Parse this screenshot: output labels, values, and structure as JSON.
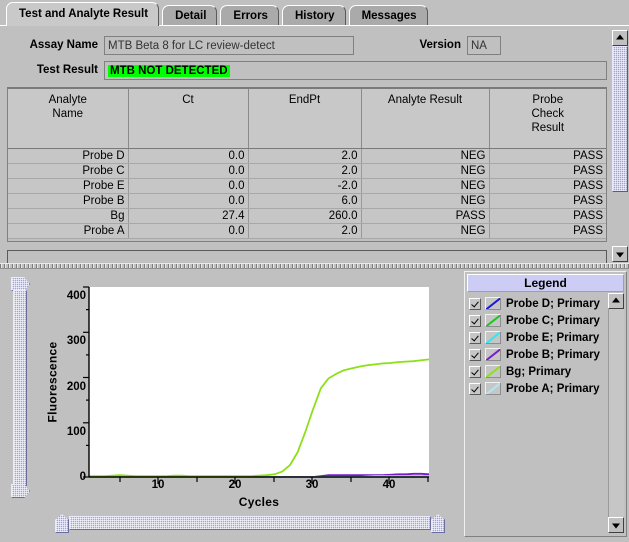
{
  "tabs": [
    {
      "label": "Test and Analyte Result",
      "active": true
    },
    {
      "label": "Detail",
      "active": false
    },
    {
      "label": "Errors",
      "active": false
    },
    {
      "label": "History",
      "active": false
    },
    {
      "label": "Messages",
      "active": false
    }
  ],
  "fields": {
    "assay_name_label": "Assay Name",
    "assay_name_value": "MTB Beta 8 for LC review-detect",
    "version_label": "Version",
    "version_value": "NA",
    "test_result_label": "Test Result",
    "test_result_value": "MTB NOT DETECTED",
    "test_result_highlight": "#00ff00"
  },
  "table": {
    "columns": [
      "Analyte\nName",
      "Ct",
      "EndPt",
      "Analyte Result",
      "Probe\nCheck\nResult"
    ],
    "columns_display": [
      {
        "line1": "Analyte",
        "line2": "Name",
        "line3": ""
      },
      {
        "line1": "Ct",
        "line2": "",
        "line3": ""
      },
      {
        "line1": "EndPt",
        "line2": "",
        "line3": ""
      },
      {
        "line1": "Analyte Result",
        "line2": "",
        "line3": ""
      },
      {
        "line1": "Probe",
        "line2": "Check",
        "line3": "Result"
      }
    ],
    "rows": [
      {
        "analyte": "Probe D",
        "ct": "0.0",
        "endpt": "2.0",
        "analyte_result": "NEG",
        "probe_check": "PASS"
      },
      {
        "analyte": "Probe C",
        "ct": "0.0",
        "endpt": "2.0",
        "analyte_result": "NEG",
        "probe_check": "PASS"
      },
      {
        "analyte": "Probe E",
        "ct": "0.0",
        "endpt": "-2.0",
        "analyte_result": "NEG",
        "probe_check": "PASS"
      },
      {
        "analyte": "Probe B",
        "ct": "0.0",
        "endpt": "6.0",
        "analyte_result": "NEG",
        "probe_check": "PASS"
      },
      {
        "analyte": "Bg",
        "ct": "27.4",
        "endpt": "260.0",
        "analyte_result": "PASS",
        "probe_check": "PASS"
      },
      {
        "analyte": "Probe A",
        "ct": "0.0",
        "endpt": "2.0",
        "analyte_result": "NEG",
        "probe_check": "PASS"
      }
    ]
  },
  "legend": {
    "title": "Legend",
    "items": [
      {
        "label": "Probe D; Primary",
        "color": "#1818d8",
        "checked": true
      },
      {
        "label": "Probe C; Primary",
        "color": "#18c818",
        "checked": true
      },
      {
        "label": "Probe E; Primary",
        "color": "#30e8f0",
        "checked": true
      },
      {
        "label": "Probe B; Primary",
        "color": "#7a1ad0",
        "checked": true
      },
      {
        "label": "Bg; Primary",
        "color": "#8ce018",
        "checked": true
      },
      {
        "label": "Probe A; Primary",
        "color": "#b0e8f0",
        "checked": true
      }
    ]
  },
  "chart_data": {
    "type": "line",
    "title": "",
    "xlabel": "Cycles",
    "ylabel": "Fluorescence",
    "xlim": [
      1,
      45
    ],
    "ylim": [
      0,
      420
    ],
    "xticks": [
      10,
      20,
      30,
      40
    ],
    "xminor_step": 5,
    "yticks": [
      0,
      100,
      200,
      300,
      400
    ],
    "yminor": [
      50,
      150,
      250,
      350
    ],
    "grid": false,
    "legend_position": "right-panel",
    "x": [
      1,
      2,
      3,
      4,
      5,
      6,
      7,
      8,
      9,
      10,
      11,
      12,
      13,
      14,
      15,
      16,
      17,
      18,
      19,
      20,
      21,
      22,
      23,
      24,
      25,
      26,
      27,
      28,
      29,
      30,
      31,
      32,
      33,
      34,
      35,
      36,
      37,
      38,
      39,
      40,
      41,
      42,
      43,
      44,
      45
    ],
    "series": [
      {
        "name": "Bg; Primary",
        "color": "#8ce018",
        "values": [
          2,
          2,
          2,
          3,
          4,
          3,
          2,
          2,
          2,
          2,
          2,
          3,
          3,
          2,
          2,
          2,
          2,
          2,
          2,
          2,
          2,
          2,
          3,
          4,
          6,
          12,
          26,
          55,
          100,
          150,
          196,
          218,
          228,
          236,
          240,
          244,
          247,
          249,
          251,
          252,
          254,
          255,
          256,
          258,
          260
        ]
      },
      {
        "name": "Probe D; Primary",
        "color": "#1818d8",
        "values": [
          0,
          0,
          0,
          0,
          0,
          0,
          0,
          0,
          0,
          0,
          0,
          0,
          0,
          0,
          0,
          0,
          0,
          0,
          0,
          0,
          0,
          0,
          0,
          0,
          0,
          0,
          0,
          0,
          0,
          0,
          0,
          0,
          0,
          0,
          0,
          1,
          2,
          2,
          2,
          2,
          2,
          2,
          2,
          2,
          2
        ]
      },
      {
        "name": "Probe C; Primary",
        "color": "#18c818",
        "values": [
          0,
          0,
          0,
          0,
          0,
          0,
          0,
          0,
          0,
          0,
          0,
          0,
          0,
          0,
          0,
          0,
          0,
          0,
          0,
          0,
          0,
          0,
          0,
          0,
          0,
          0,
          0,
          0,
          0,
          0,
          0,
          0,
          0,
          0,
          0,
          0,
          0,
          0,
          0,
          1,
          2,
          2,
          2,
          2,
          2
        ]
      },
      {
        "name": "Probe E; Primary",
        "color": "#30e8f0",
        "values": [
          0,
          0,
          0,
          0,
          0,
          0,
          0,
          0,
          0,
          0,
          0,
          0,
          0,
          0,
          0,
          0,
          0,
          0,
          0,
          0,
          0,
          0,
          0,
          0,
          0,
          0,
          0,
          0,
          0,
          0,
          0,
          0,
          0,
          0,
          0,
          -1,
          -2,
          -2,
          -2,
          -2,
          -2,
          -2,
          -2,
          -2,
          -2
        ]
      },
      {
        "name": "Probe B; Primary",
        "color": "#7a1ad0",
        "values": [
          0,
          0,
          0,
          0,
          0,
          0,
          0,
          0,
          0,
          0,
          0,
          0,
          0,
          0,
          0,
          0,
          0,
          0,
          0,
          0,
          0,
          0,
          0,
          0,
          0,
          0,
          0,
          0,
          0,
          0,
          2,
          4,
          4,
          4,
          4,
          4,
          4,
          4,
          4,
          5,
          6,
          6,
          7,
          7,
          6
        ]
      },
      {
        "name": "Probe A; Primary",
        "color": "#b0e8f0",
        "values": [
          0,
          0,
          0,
          0,
          0,
          0,
          0,
          0,
          0,
          0,
          0,
          0,
          0,
          0,
          0,
          0,
          0,
          0,
          0,
          0,
          0,
          0,
          0,
          0,
          0,
          0,
          0,
          0,
          0,
          0,
          0,
          0,
          0,
          0,
          0,
          0,
          1,
          2,
          2,
          2,
          2,
          2,
          2,
          2,
          2
        ]
      }
    ]
  }
}
